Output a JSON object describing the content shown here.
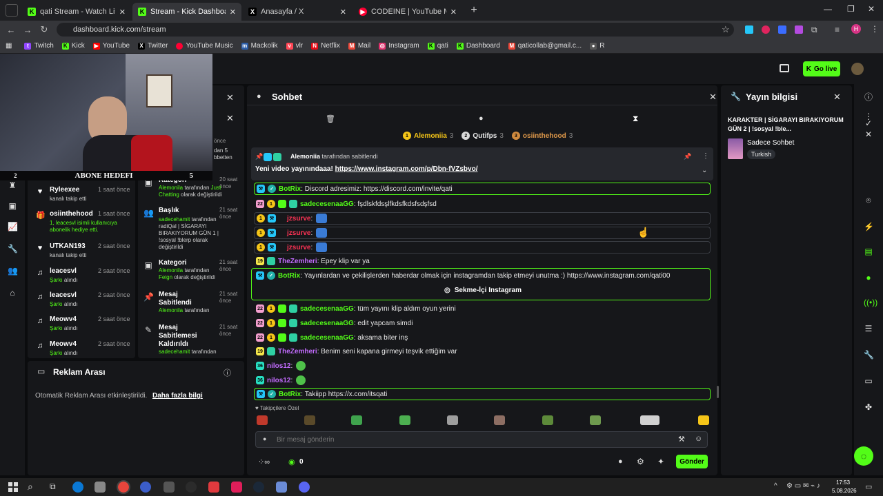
{
  "browser": {
    "tabs": [
      {
        "title": "qati Stream - Watch Live on Kick",
        "fav": "K",
        "color": "#53fc18"
      },
      {
        "title": "Stream - Kick Dashboard",
        "fav": "K",
        "color": "#53fc18"
      },
      {
        "title": "Anasayfa / X",
        "fav": "X",
        "color": "#ffffff"
      },
      {
        "title": "CODEINE | YouTube Music",
        "fav": "▶",
        "color": "#ff0033"
      }
    ],
    "url": "dashboard.kick.com/stream",
    "bookmarks": [
      "Twitch",
      "Kick",
      "YouTube",
      "Twitter",
      "YouTube Music",
      "Mackolik",
      "vlr",
      "Netflix",
      "Mail",
      "Instagram",
      "qati",
      "Dashboard",
      "qaticollab@gmail.c...",
      "R"
    ],
    "profile_initial": "H"
  },
  "header": {
    "go_live": "Go live"
  },
  "webcam": {
    "goal_label": "ABONE HEDEFI",
    "goal_count": "5",
    "goal_current": "2"
  },
  "activity": [
    {
      "name": "Ryleexee",
      "time": "1 saat önce",
      "sub": "kanalı takip etti",
      "icon": "heart"
    },
    {
      "name": "osiinthehood",
      "time": "1 saat önce",
      "sub": "1, leacesvl isimli kullanıcıya abonelik hediye etti.",
      "icon": "gift"
    },
    {
      "name": "UTKAN193",
      "time": "2 saat önce",
      "sub": "kanalı takip etti",
      "icon": "heart"
    },
    {
      "name": "leacesvl",
      "time": "2 saat önce",
      "sub_hl": "Şarkı",
      "sub": " alındı",
      "icon": "music"
    },
    {
      "name": "leacesvl",
      "time": "2 saat önce",
      "sub_hl": "Şarkı",
      "sub": " alındı",
      "icon": "music"
    },
    {
      "name": "Meowv4",
      "time": "2 saat önce",
      "sub_hl": "Şarkı",
      "sub": " alındı",
      "icon": "music"
    },
    {
      "name": "Meowv4",
      "time": "2 saat önce",
      "sub_hl": "Şarkı",
      "sub": " alındı",
      "icon": "music"
    }
  ],
  "events_partial": [
    "önce",
    "dan 5",
    "bbetten"
  ],
  "events": [
    {
      "title": "Kategori",
      "time": "20 saat önce",
      "hl": "Alemonila",
      "mid": " tarafından ",
      "hl2": "Just Chatting",
      "end": " olarak değiştirildi"
    },
    {
      "title": "Başlık",
      "time": "21 saat önce",
      "hl": "sadecehamit",
      "mid": " tarafından ",
      "hl2": "",
      "end": "radiQal | SİGARAYI BIRAKIYORUM GÜN 1 | !sosyal !blerp olarak değiştirildi"
    },
    {
      "title": "Kategori",
      "time": "21 saat önce",
      "hl": "Alemonila",
      "mid": " tarafından ",
      "hl2": "Feign",
      "end": " olarak değiştirildi"
    },
    {
      "title": "Mesaj Sabitlendi",
      "time": "21 saat önce",
      "hl": "Alemonila",
      "mid": " tarafından",
      "hl2": "",
      "end": ""
    },
    {
      "title": "Mesaj Sabitlemesi Kaldırıldı",
      "time": "21 saat önce",
      "hl": "sadecehamit",
      "mid": " tarafından",
      "hl2": "",
      "end": ""
    }
  ],
  "ads": {
    "title": "Reklam Arası",
    "text": "Otomatik Reklam Arası etkinleştirildi.",
    "link": "Daha fazla bilgi"
  },
  "chat": {
    "title": "Sohbet",
    "top_gifters": [
      {
        "rank": "1",
        "name": "Alemoniia",
        "count": "3"
      },
      {
        "rank": "2",
        "name": "Qutifps",
        "count": "3"
      },
      {
        "rank": "3",
        "name": "osiinthehood",
        "count": "3"
      }
    ],
    "pinned_by": "Alemoniia",
    "pinned_by_suffix": "tarafından sabitlendi",
    "pinned_text": "Yeni video yayınındaaa!",
    "pinned_link": "https://www.instagram.com/p/Dbn-fVZsbvo/",
    "messages": [
      {
        "user": "BotRix",
        "color": "#53fc18",
        "text": "Discord adresimiz: https://discord.com/invite/qati",
        "badges": [
          "mod",
          "ver"
        ],
        "style": "box"
      },
      {
        "user": "sadecesenaaGG",
        "color": "#53fc18",
        "text": "fşdlskfdsşlfkdsfkdsfsdşfsd",
        "badges": [
          "sub",
          "og",
          "vip",
          "gift"
        ],
        "style": ""
      },
      {
        "user": "jzsurve",
        "color": "#ff3355",
        "text": "",
        "badges": [
          "og",
          "mod"
        ],
        "style": "gry",
        "emote": "blue"
      },
      {
        "user": "jzsurve",
        "color": "#ff3355",
        "text": "",
        "badges": [
          "og",
          "mod"
        ],
        "style": "gry",
        "emote": "blue"
      },
      {
        "user": "jzsurve",
        "color": "#ff3355",
        "text": "",
        "badges": [
          "og",
          "mod"
        ],
        "style": "gry",
        "emote": "blue"
      },
      {
        "user": "TheZemheri",
        "color": "#c36cff",
        "text": "Epey klip var ya",
        "badges": [
          "19",
          "gift"
        ],
        "style": ""
      },
      {
        "user": "BotRix",
        "color": "#53fc18",
        "text": "Yayınlardan ve çekilişlerden haberdar olmak için instagramdan takip etmeyi unutma :) https://www.instagram.com/qati00",
        "badges": [
          "mod",
          "ver"
        ],
        "style": "box"
      },
      {
        "user": "sadecesenaaGG",
        "color": "#53fc18",
        "text": "tüm yayını klip aldım oyun yerini",
        "badges": [
          "sub",
          "og",
          "vip",
          "gift"
        ],
        "style": ""
      },
      {
        "user": "sadecesenaaGG",
        "color": "#53fc18",
        "text": "edit yapcam simdi",
        "badges": [
          "sub",
          "og",
          "vip",
          "gift"
        ],
        "style": ""
      },
      {
        "user": "sadecesenaaGG",
        "color": "#53fc18",
        "text": "aksama biter inş",
        "badges": [
          "sub",
          "og",
          "vip",
          "gift"
        ],
        "style": ""
      },
      {
        "user": "TheZemheri",
        "color": "#c36cff",
        "text": "Benim seni kapana girmeyi teşvik ettiğim var",
        "badges": [
          "19",
          "gift"
        ],
        "style": ""
      },
      {
        "user": "nilos12",
        "color": "#c36cff",
        "text": "",
        "badges": [
          "36"
        ],
        "style": "",
        "emote": "green"
      },
      {
        "user": "nilos12",
        "color": "#c36cff",
        "text": "",
        "badges": [
          "36"
        ],
        "style": "",
        "emote": "green"
      },
      {
        "user": "BotRix",
        "color": "#53fc18",
        "text": "Takiipp https://x.com/itsqati",
        "badges": [
          "mod",
          "ver"
        ],
        "style": "box"
      }
    ],
    "insta_button": "Sekme-İçi Instagram",
    "followers_only": "Takipçilere Özel",
    "input_placeholder": "Bir mesaj gönderin",
    "points": "0",
    "send": "Gönder"
  },
  "stream_info": {
    "title": "Yayın bilgisi",
    "stream_title": "KARAKTER | SİGARAYI BIRAKIYORUM GÜN 2 | !sosyal !ble...",
    "category": "Sadece Sohbet",
    "language": "Turkish"
  },
  "taskbar": {
    "time": "17:53",
    "date": "5.08.2026"
  }
}
